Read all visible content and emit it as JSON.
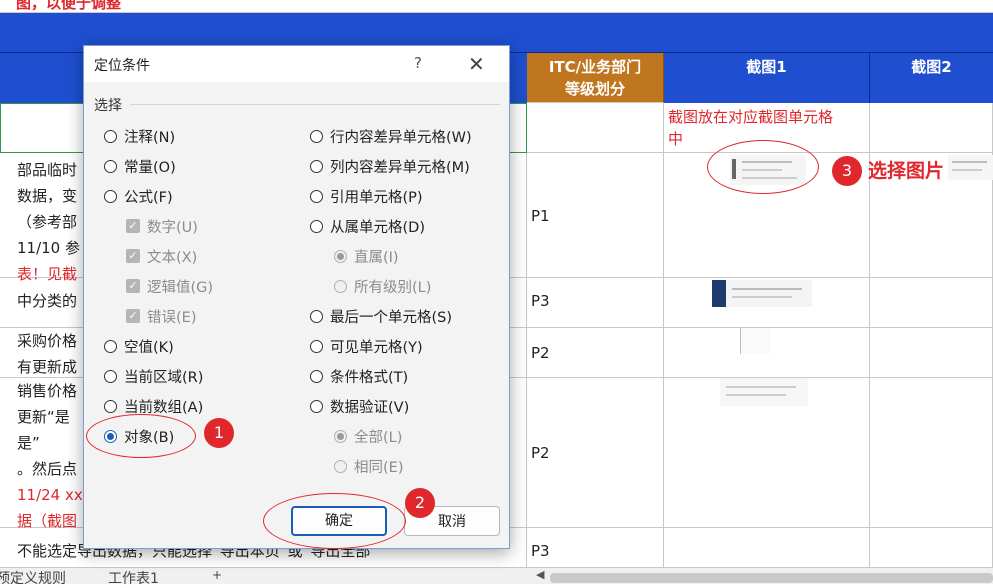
{
  "sheet": {
    "top_note": "图，以便于调整",
    "headers": {
      "level_line1": "ITC/业务部门",
      "level_line2": "等级划分",
      "shot1": "截图1",
      "shot2": "截图2"
    },
    "note_row_red": "截图放在对应截图单元格\n中",
    "rows": [
      {
        "desc": "部品临时\n数据，变\n（参考部\n11/10 参",
        "desc_red": "表！见截",
        "level": "P1"
      },
      {
        "desc": "中分类的",
        "level": "P3"
      },
      {
        "desc": "采购价格\n有更新成",
        "level": "P2"
      },
      {
        "desc": "销售价格\n更新“是\n是”\n。然后点",
        "desc_red": "11/24 xx\n据（截图",
        "level": "P2"
      },
      {
        "desc": "不能选定导出数据，只能选择“导出本页”或“导出全部",
        "level": "P3"
      }
    ],
    "tabs": [
      "预定义规则",
      "工作表1",
      "+"
    ]
  },
  "annotations": {
    "badge1": "1",
    "badge2": "2",
    "badge3": "3",
    "select_picture": "选择图片"
  },
  "dialog": {
    "title": "定位条件",
    "help": "?",
    "close": "✕",
    "group": "选择",
    "left_options": [
      {
        "label": "注释(N)",
        "state": "off"
      },
      {
        "label": "常量(O)",
        "state": "off"
      },
      {
        "label": "公式(F)",
        "state": "off"
      },
      {
        "label": "数字(U)",
        "state": "check-dis"
      },
      {
        "label": "文本(X)",
        "state": "check-dis"
      },
      {
        "label": "逻辑值(G)",
        "state": "check-dis"
      },
      {
        "label": "错误(E)",
        "state": "check-dis"
      },
      {
        "label": "空值(K)",
        "state": "off"
      },
      {
        "label": "当前区域(R)",
        "state": "off"
      },
      {
        "label": "当前数组(A)",
        "state": "off"
      },
      {
        "label": "对象(B)",
        "state": "on"
      }
    ],
    "right_options": [
      {
        "label": "行内容差异单元格(W)",
        "state": "off"
      },
      {
        "label": "列内容差异单元格(M)",
        "state": "off"
      },
      {
        "label": "引用单元格(P)",
        "state": "off"
      },
      {
        "label": "从属单元格(D)",
        "state": "off"
      },
      {
        "label": "直属(I)",
        "state": "dis-on"
      },
      {
        "label": "所有级别(L)",
        "state": "dis-off"
      },
      {
        "label": "最后一个单元格(S)",
        "state": "off"
      },
      {
        "label": "可见单元格(Y)",
        "state": "off"
      },
      {
        "label": "条件格式(T)",
        "state": "off"
      },
      {
        "label": "数据验证(V)",
        "state": "off"
      },
      {
        "label": "全部(L)",
        "state": "dis-on"
      },
      {
        "label": "相同(E)",
        "state": "dis-off"
      }
    ],
    "ok": "确定",
    "cancel": "取消"
  },
  "colors": {
    "accent_red": "#e0272c",
    "header_blue": "#1f4fd0",
    "header_brown": "#c0761e",
    "radio_blue": "#1a5fb4"
  }
}
